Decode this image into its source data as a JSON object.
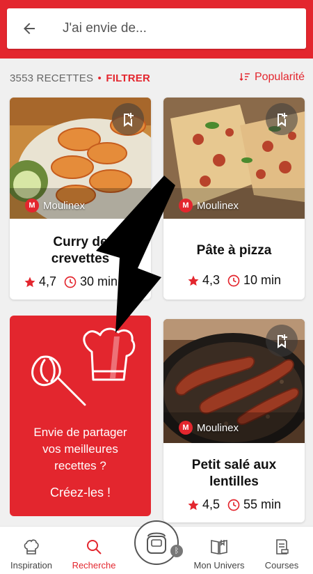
{
  "search": {
    "placeholder": "J'ai envie de..."
  },
  "filterbar": {
    "count": "3553 RECETTES",
    "separator": "•",
    "filter_label": "FILTRER",
    "sort_label": "Popularité"
  },
  "recipes": [
    {
      "title_line1": "Curry de",
      "title_line2": "crevettes",
      "brand": "Moulinex",
      "rating": "4,7",
      "time": "30 min"
    },
    {
      "title_line1": "Pâte à pizza",
      "title_line2": "",
      "brand": "Moulinex",
      "rating": "4,3",
      "time": "10 min"
    },
    {
      "title_line1": "Petit salé aux",
      "title_line2": "lentilles",
      "brand": "Moulinex",
      "rating": "4,5",
      "time": "55 min"
    }
  ],
  "promo": {
    "line1": "Envie de partager",
    "line2": "vos meilleures",
    "line3": "recettes ?",
    "cta": "Créez-les !"
  },
  "tabs": [
    {
      "label": "Inspiration",
      "icon": "chef-hat-icon"
    },
    {
      "label": "Recherche",
      "icon": "search-icon"
    },
    {
      "label": "Mon Univers",
      "icon": "book-icon"
    },
    {
      "label": "Courses",
      "icon": "shopping-list-icon"
    }
  ],
  "bluetooth_badge": "ᛒ",
  "colors": {
    "brand_red": "#e3262e"
  }
}
